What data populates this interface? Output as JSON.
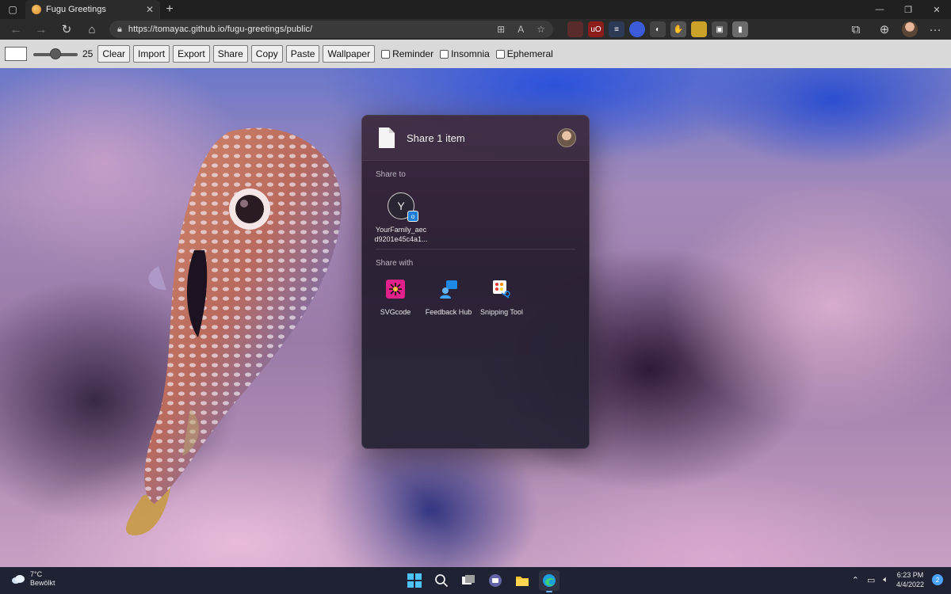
{
  "browser": {
    "tab_title": "Fugu Greetings",
    "tab_close": "✕",
    "new_tab": "+",
    "url": "https://tomayac.github.io/fugu-greetings/public/",
    "window_controls": [
      "—",
      "❐",
      "✕"
    ],
    "menu_label": "···"
  },
  "toolbar": {
    "brush_size": "25",
    "brush_fraction": 0.5,
    "buttons": {
      "clear": "Clear",
      "import": "Import",
      "export": "Export",
      "share": "Share",
      "copy": "Copy",
      "paste": "Paste",
      "wallpaper": "Wallpaper"
    },
    "checkboxes": {
      "reminder": "Reminder",
      "insomnia": "Insomnia",
      "ephemeral": "Ephemeral"
    }
  },
  "share_sheet": {
    "title": "Share 1 item",
    "share_to_label": "Share to",
    "contact": {
      "initial": "Y",
      "name_line1": "YourFamily_aec",
      "name_line2": "d9201e45c4a1..."
    },
    "share_with_label": "Share with",
    "apps": [
      {
        "name": "SVGcode",
        "icon": "svgcode-icon",
        "color": "#e0218a"
      },
      {
        "name": "Feedback Hub",
        "icon": "feedback-hub-icon",
        "color": "#1e88e5"
      },
      {
        "name": "Snipping Tool",
        "icon": "snipping-tool-icon",
        "color": "#e53935"
      }
    ]
  },
  "taskbar": {
    "weather_temp": "7°C",
    "weather_desc": "Bewölkt",
    "time": "6:23 PM",
    "date": "4/4/2022",
    "notifications": "2"
  },
  "colors": {
    "accent": "#1e88e5",
    "toolbar_bg": "#d9d9d9",
    "taskbar_bg": "#1e2233"
  }
}
